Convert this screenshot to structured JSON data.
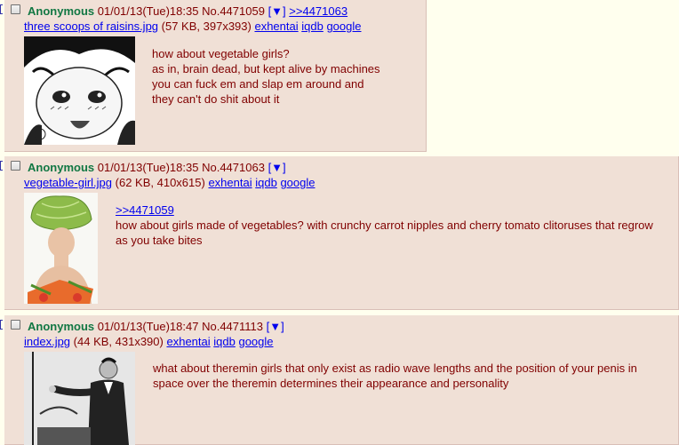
{
  "posts": [
    {
      "name": "Anonymous",
      "datetime": "01/01/13(Tue)18:35",
      "number": "No.4471059",
      "menu": "[▼]",
      "reply_link": ">>4471063",
      "file_name": "three scoops of raisins.jpg",
      "file_info": "(57 KB, 397x393)",
      "links": [
        "exhentai",
        "iqdb",
        "google"
      ],
      "message": [
        "how about vegetable girls?",
        "as in, brain dead, but kept alive by machines",
        "you can fuck em and slap em around and",
        "they can't do shit about it"
      ]
    },
    {
      "name": "Anonymous",
      "datetime": "01/01/13(Tue)18:35",
      "number": "No.4471063",
      "menu": "[▼]",
      "file_name": "vegetable-girl.jpg",
      "file_info": "(62 KB, 410x615)",
      "links": [
        "exhentai",
        "iqdb",
        "google"
      ],
      "quote": ">>4471059",
      "message": [
        "how about girls made of vegetables? with crunchy carrot nipples and cherry tomato clitoruses that regrow",
        "as you take bites"
      ]
    },
    {
      "name": "Anonymous",
      "datetime": "01/01/13(Tue)18:47",
      "number": "No.4471113",
      "menu": "[▼]",
      "file_name": "index.jpg",
      "file_info": "(44 KB, 431x390)",
      "links": [
        "exhentai",
        "iqdb",
        "google"
      ],
      "message": [
        "what about theremin girls that only exist as radio wave lengths and the position of your penis in",
        "space over the theremin determines their appearance and personality"
      ]
    }
  ],
  "colors": {
    "page_bg": "#FFFFEE",
    "post_bg": "#F0E0D6",
    "name": "#117743",
    "text": "#800000",
    "link": "#0000EE"
  }
}
